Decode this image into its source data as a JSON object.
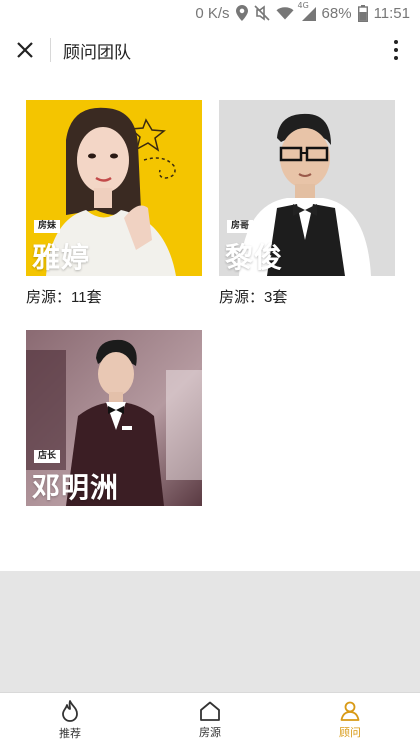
{
  "status_bar": {
    "speed": "0 K/s",
    "network": "4G",
    "battery": "68%",
    "time": "11:51",
    "icons": [
      "location-icon",
      "mute-icon",
      "wifi-icon",
      "signal-icon",
      "battery-icon"
    ]
  },
  "header": {
    "close_icon": "close-icon",
    "title": "顾问团队",
    "more_icon": "more-vertical-icon"
  },
  "advisors": [
    {
      "role": "房妹",
      "name": "雅婷",
      "listings_label": "房源：",
      "listings_count": "11",
      "listings_unit": "套",
      "photo_bg": "#f2c300"
    },
    {
      "role": "房哥",
      "name": "黎俊",
      "listings_label": "房源：",
      "listings_count": "3",
      "listings_unit": "套",
      "photo_bg": "#d9d9d9"
    },
    {
      "role": "店长",
      "name": "邓明洲",
      "listings_label": "",
      "listings_count": "",
      "listings_unit": "",
      "photo_bg": "#6b4a52"
    }
  ],
  "tabs": [
    {
      "label": "推荐",
      "icon": "flame-icon",
      "active": false
    },
    {
      "label": "房源",
      "icon": "house-icon",
      "active": false
    },
    {
      "label": "顾问",
      "icon": "person-icon",
      "active": true
    }
  ],
  "colors": {
    "accent": "#d89a16",
    "gray_band": "#e5e5e5"
  }
}
